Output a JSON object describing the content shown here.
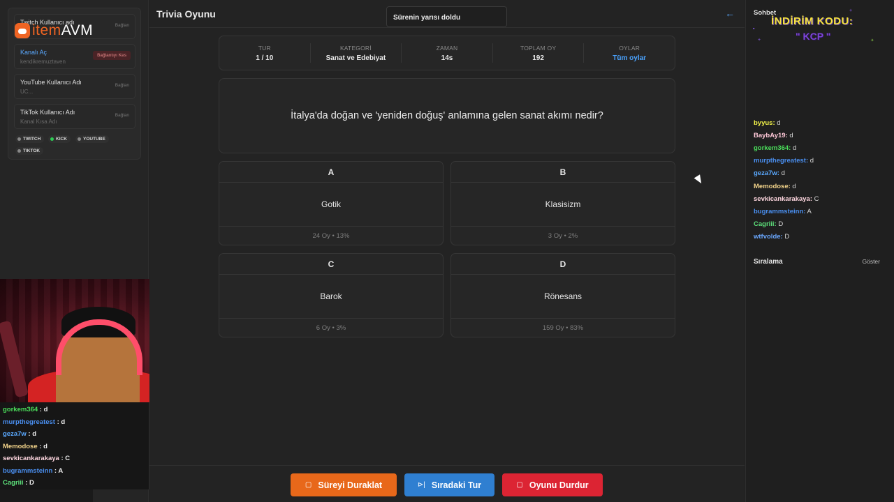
{
  "connections": {
    "rows": [
      {
        "label": "Twitch Kullanıcı adı",
        "sub": "",
        "button": "Bağlan"
      },
      {
        "label": "Kanalı Aç",
        "sub": "kendikremuztaven",
        "button": "Bağlantıyı Kes"
      },
      {
        "label": "YouTube Kullanıcı Adı",
        "sub": "UC...",
        "button": "Bağlan"
      },
      {
        "label": "TikTok Kullanıcı Adı",
        "sub": "Kanal Kısa Adı",
        "button": "Bağlan"
      }
    ],
    "platforms": [
      "TWITCH",
      "KICK",
      "YOUTUBE",
      "TIKTOK"
    ]
  },
  "logo": {
    "part1": "item",
    "part2": "AVM"
  },
  "overlay_chat": [
    {
      "user": "gorkem364",
      "msg": " : d",
      "color": "#4ade5a"
    },
    {
      "user": "murpthegreatest",
      "msg": " : d",
      "color": "#4a8ff0"
    },
    {
      "user": "geza7w",
      "msg": " : d",
      "color": "#5aa9ff"
    },
    {
      "user": "Memodose",
      "msg": " : d",
      "color": "#f2d38a"
    },
    {
      "user": "sevkicankarakaya",
      "msg": " : C",
      "color": "#ffd7e0"
    },
    {
      "user": "bugrammsteinn",
      "msg": " : A",
      "color": "#4a8ff0"
    },
    {
      "user": "Cagriii",
      "msg": " : D",
      "color": "#5de07a"
    }
  ],
  "main": {
    "title": "Trivia Oyunu",
    "toast": "Sürenin yarısı doldu",
    "stats": [
      {
        "key": "TUR",
        "value": "1 / 10"
      },
      {
        "key": "KATEGORİ",
        "value": "Sanat ve Edebiyat"
      },
      {
        "key": "ZAMAN",
        "value": "14s"
      },
      {
        "key": "TOPLAM OY",
        "value": "192"
      },
      {
        "key": "OYLAR",
        "value": "Tüm oylar"
      }
    ],
    "question": "İtalya'da doğan ve 'yeniden doğuş' anlamına gelen sanat akımı nedir?",
    "options": [
      {
        "letter": "A",
        "answer": "Gotik",
        "votes": "24 Oy • 13%"
      },
      {
        "letter": "B",
        "answer": "Klasisizm",
        "votes": "3 Oy • 2%"
      },
      {
        "letter": "C",
        "answer": "Barok",
        "votes": "6 Oy • 3%"
      },
      {
        "letter": "D",
        "answer": "Rönesans",
        "votes": "159 Oy • 83%"
      }
    ],
    "controls": [
      {
        "label": "Süreyi Duraklat",
        "icon": "▢",
        "color": "#e8681a"
      },
      {
        "label": "Sıradaki Tur",
        "icon": "⊳|",
        "color": "#2f7fd1"
      },
      {
        "label": "Oyunu Durdur",
        "icon": "▢",
        "color": "#dc2433"
      }
    ]
  },
  "chat": {
    "title": "Sohbet",
    "promo_line1": "İNDİRİM KODU:",
    "promo_line2": "\" KCP \"",
    "messages": [
      {
        "user": "byyus:",
        "msg": " d",
        "color": "#f5f54a"
      },
      {
        "user": "BaybAy19:",
        "msg": " d",
        "color": "#ffc8d8"
      },
      {
        "user": "gorkem364:",
        "msg": " d",
        "color": "#4ade5a"
      },
      {
        "user": "murpthegreatest:",
        "msg": " d",
        "color": "#4a8ff0"
      },
      {
        "user": "geza7w:",
        "msg": " d",
        "color": "#5aa9ff"
      },
      {
        "user": "Memodose:",
        "msg": " d",
        "color": "#f2d38a"
      },
      {
        "user": "sevkicankarakaya:",
        "msg": " C",
        "color": "#ffd7e0"
      },
      {
        "user": "bugrammsteinn:",
        "msg": " A",
        "color": "#4a8ff0"
      },
      {
        "user": "Cagriii:",
        "msg": " D",
        "color": "#5de07a"
      },
      {
        "user": "wtfvolde:",
        "msg": " D",
        "color": "#6aa8ff"
      }
    ],
    "ranking_title": "Sıralama",
    "ranking_button": "Göster"
  }
}
